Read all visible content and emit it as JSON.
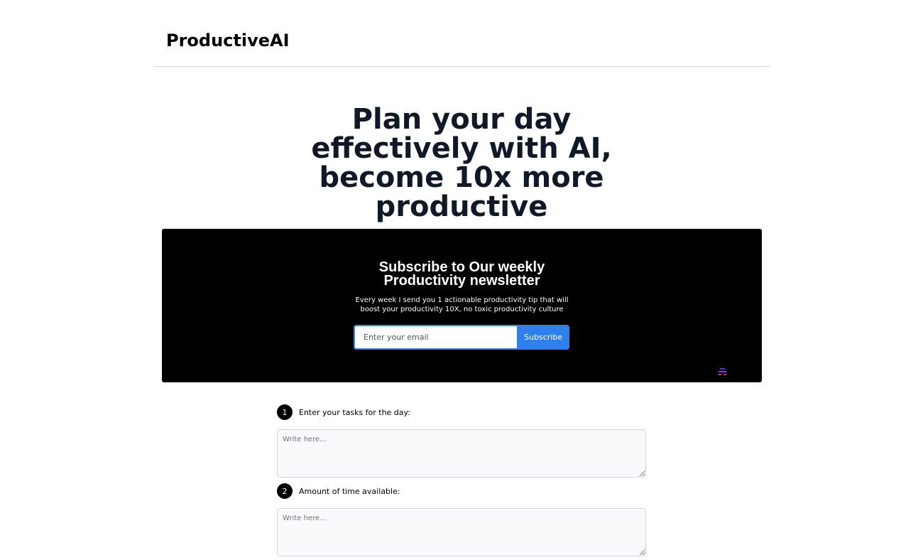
{
  "header": {
    "brand": "ProductiveAI"
  },
  "hero": {
    "title": "Plan your day effectively with AI, become 10x more productive"
  },
  "newsletter": {
    "title_line1": "Subscribe to Our weekly",
    "title_line2": "Productivity newsletter",
    "description": "Every week I send you 1 actionable productivity tip that will boost your productivity 10X, no toxic productivity culture",
    "email_placeholder": "Enter your email",
    "subscribe_label": "Subscribe",
    "badge_icon": "stack-logo-icon",
    "colors": {
      "background": "#000000",
      "button": "#2f80ed",
      "input_border": "#3b82f6"
    }
  },
  "form": {
    "steps": [
      {
        "number": "1",
        "label": "Enter your tasks for the day:",
        "placeholder": "Write here..."
      },
      {
        "number": "2",
        "label": "Amount of time available:",
        "placeholder": "Write here..."
      }
    ]
  }
}
